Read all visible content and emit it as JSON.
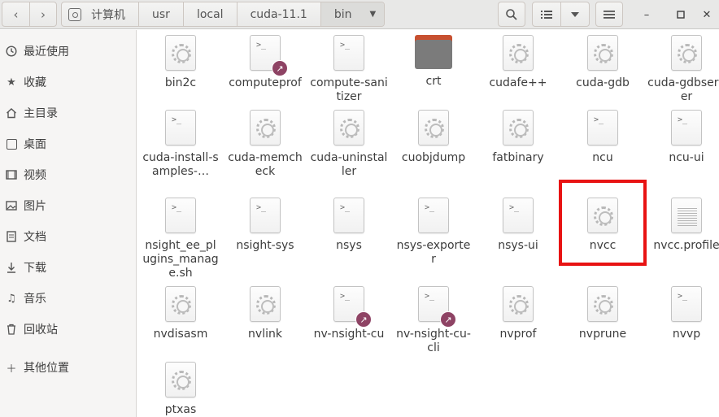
{
  "header": {
    "back_icon": "chevron-left-icon",
    "forward_icon": "chevron-right-icon",
    "breadcrumbs": [
      "计算机",
      "usr",
      "local",
      "cuda-11.1",
      "bin"
    ],
    "search_icon": "search-icon",
    "list_view_icon": "list-view-icon",
    "view_options_icon": "chevron-down-icon",
    "menu_icon": "hamburger-menu-icon"
  },
  "sidebar": {
    "items": [
      {
        "label": "最近使用",
        "icon": "clock-icon"
      },
      {
        "label": "收藏",
        "icon": "star-icon"
      },
      {
        "label": "主目录",
        "icon": "home-icon"
      },
      {
        "label": "桌面",
        "icon": "desktop-icon"
      },
      {
        "label": "视频",
        "icon": "video-icon"
      },
      {
        "label": "图片",
        "icon": "image-icon"
      },
      {
        "label": "文档",
        "icon": "document-icon"
      },
      {
        "label": "下载",
        "icon": "download-icon"
      },
      {
        "label": "音乐",
        "icon": "music-icon"
      },
      {
        "label": "回收站",
        "icon": "trash-icon"
      },
      {
        "label": "其他位置",
        "icon": "plus-icon"
      }
    ]
  },
  "files": [
    {
      "name": "bin2c",
      "type": "gear"
    },
    {
      "name": "computeprof",
      "type": "script-link"
    },
    {
      "name": "compute-sanitizer",
      "type": "script"
    },
    {
      "name": "crt",
      "type": "folder"
    },
    {
      "name": "cudafe++",
      "type": "gear"
    },
    {
      "name": "cuda-gdb",
      "type": "gear"
    },
    {
      "name": "cuda-gdbserver",
      "type": "gear"
    },
    {
      "name": "cuda-install-samples-…",
      "type": "script"
    },
    {
      "name": "cuda-memcheck",
      "type": "gear"
    },
    {
      "name": "cuda-uninstaller",
      "type": "gear"
    },
    {
      "name": "cuobjdump",
      "type": "gear"
    },
    {
      "name": "fatbinary",
      "type": "gear"
    },
    {
      "name": "ncu",
      "type": "script"
    },
    {
      "name": "ncu-ui",
      "type": "script"
    },
    {
      "name": "nsight_ee_plugins_manage.sh",
      "type": "script"
    },
    {
      "name": "nsight-sys",
      "type": "script"
    },
    {
      "name": "nsys",
      "type": "script"
    },
    {
      "name": "nsys-exporter",
      "type": "script"
    },
    {
      "name": "nsys-ui",
      "type": "script"
    },
    {
      "name": "nvcc",
      "type": "gear"
    },
    {
      "name": "nvcc.profile",
      "type": "text"
    },
    {
      "name": "nvdisasm",
      "type": "gear"
    },
    {
      "name": "nvlink",
      "type": "gear"
    },
    {
      "name": "nv-nsight-cu",
      "type": "script-link"
    },
    {
      "name": "nv-nsight-cu-cli",
      "type": "script-link"
    },
    {
      "name": "nvprof",
      "type": "gear"
    },
    {
      "name": "nvprune",
      "type": "gear"
    },
    {
      "name": "nvvp",
      "type": "script"
    },
    {
      "name": "ptxas",
      "type": "gear"
    }
  ],
  "highlight_color": "#e81313"
}
